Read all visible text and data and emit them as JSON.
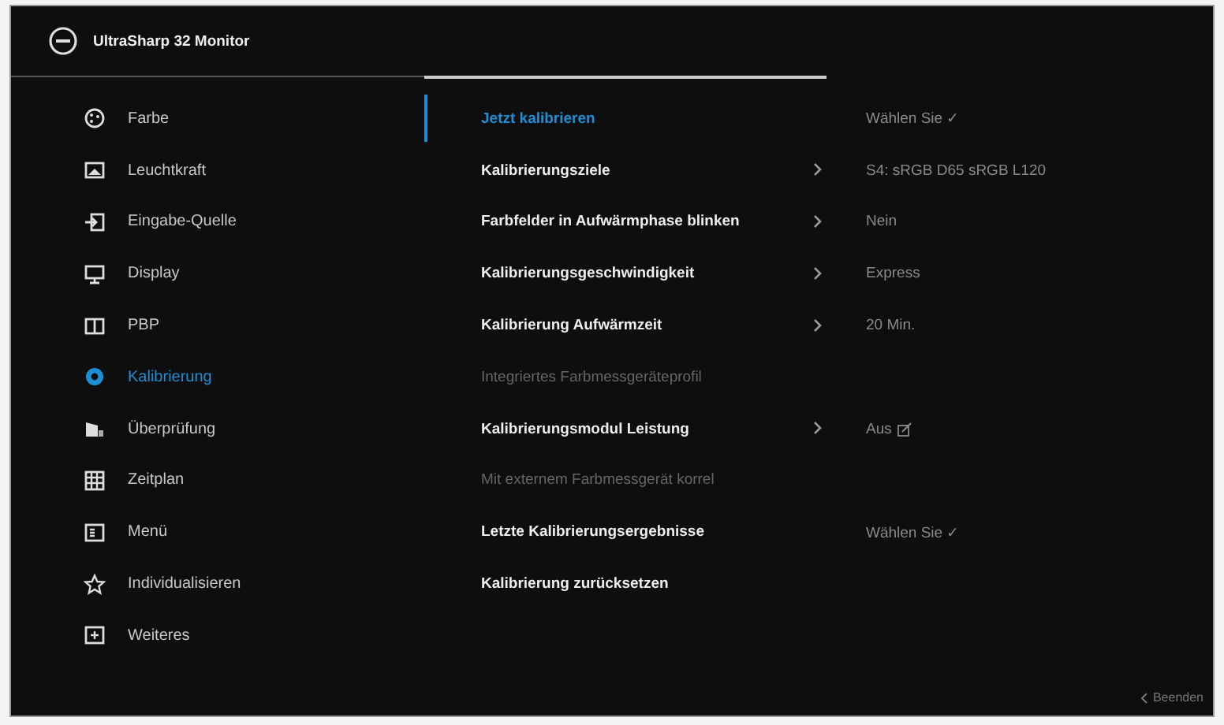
{
  "header": {
    "title": "UltraSharp  32 Monitor"
  },
  "sidebar": {
    "items": [
      {
        "label": "Farbe",
        "selected": false
      },
      {
        "label": "Leuchtkraft",
        "selected": false
      },
      {
        "label": "Eingabe-Quelle",
        "selected": false
      },
      {
        "label": "Display",
        "selected": false
      },
      {
        "label": "PBP",
        "selected": false
      },
      {
        "label": "Kalibrierung",
        "selected": true
      },
      {
        "label": "Überprüfung",
        "selected": false
      },
      {
        "label": "Zeitplan",
        "selected": false
      },
      {
        "label": "Menü",
        "selected": false
      },
      {
        "label": "Individualisieren",
        "selected": false
      },
      {
        "label": "Weiteres",
        "selected": false
      }
    ]
  },
  "settings": {
    "rows": [
      {
        "label": "Jetzt kalibrieren",
        "selected": true,
        "disabled": false,
        "submenu": false,
        "value": "Wählen Sie ✓"
      },
      {
        "label": "Kalibrierungsziele",
        "selected": false,
        "disabled": false,
        "submenu": true,
        "value": "S4: sRGB D65 sRGB L120"
      },
      {
        "label": "Farbfelder in Aufwärmphase blinken",
        "selected": false,
        "disabled": false,
        "submenu": true,
        "value": "Nein"
      },
      {
        "label": "Kalibrierungsgeschwindigkeit",
        "selected": false,
        "disabled": false,
        "submenu": true,
        "value": "Express"
      },
      {
        "label": "Kalibrierung Aufwärmzeit",
        "selected": false,
        "disabled": false,
        "submenu": true,
        "value": "20 Min."
      },
      {
        "label": "Integriertes Farbmessgeräteprofil",
        "selected": false,
        "disabled": true,
        "submenu": false
      },
      {
        "label": "Kalibrierungsmodul Leistung",
        "selected": false,
        "disabled": false,
        "submenu": true,
        "value": "Aus"
      },
      {
        "label": "Mit externem Farbmessgerät korrel",
        "selected": false,
        "disabled": true,
        "submenu": false
      },
      {
        "label": "Letzte Kalibrierungsergebnisse",
        "selected": false,
        "disabled": false,
        "submenu": false,
        "value": "Wählen Sie ✓"
      },
      {
        "label": "Kalibrierung zurücksetzen",
        "selected": false,
        "disabled": false,
        "submenu": false
      }
    ]
  },
  "footer": {
    "exit_label": "Beenden"
  }
}
